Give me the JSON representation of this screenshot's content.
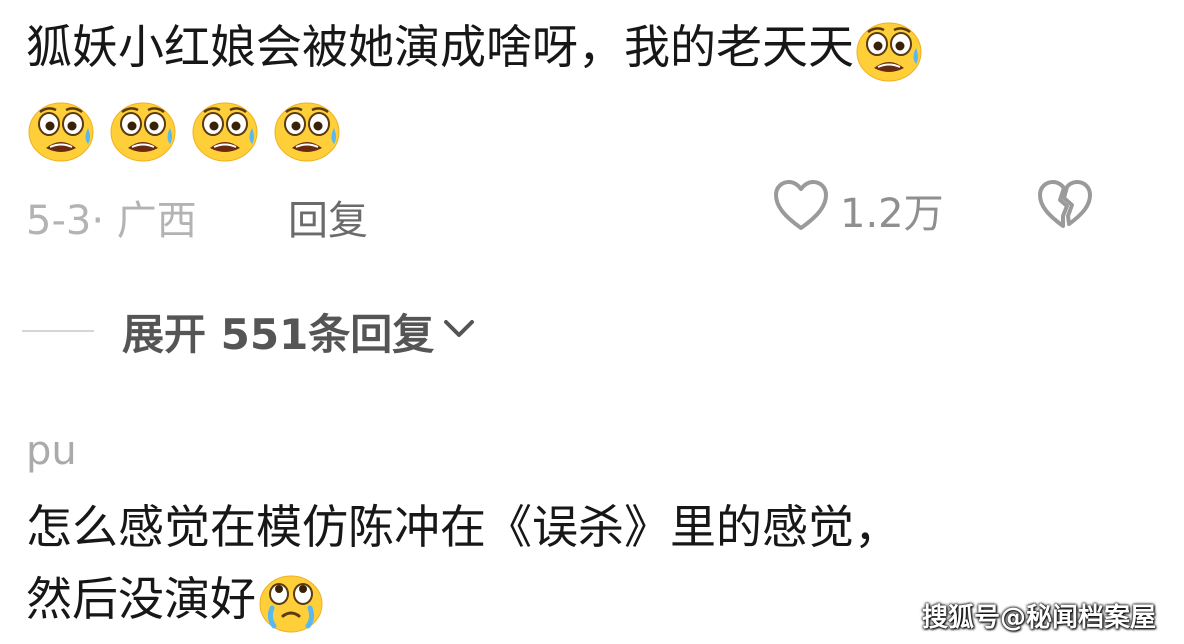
{
  "comment1": {
    "text": "狐妖小红娘会被她演成啥呀，我的老天天",
    "emoji_name": "crying-scared-emoji",
    "meta": "5-3· 广西",
    "reply_label": "回复",
    "likes": "1.2万"
  },
  "expand": {
    "label": "展开 551条回复"
  },
  "comment2": {
    "username": "pu",
    "line1": "怎么感觉在模仿陈冲在《误杀》里的感觉，",
    "line2": "然后没演好",
    "emoji_name": "teary-eyed-emoji"
  },
  "watermark": "搜狐号@秘闻档案屋",
  "colors": {
    "text": "#171717",
    "meta": "#b3b3b3",
    "reply": "#6b6b6b",
    "icon": "#9a9a9a",
    "emoji_yellow": "#ffcc33"
  }
}
